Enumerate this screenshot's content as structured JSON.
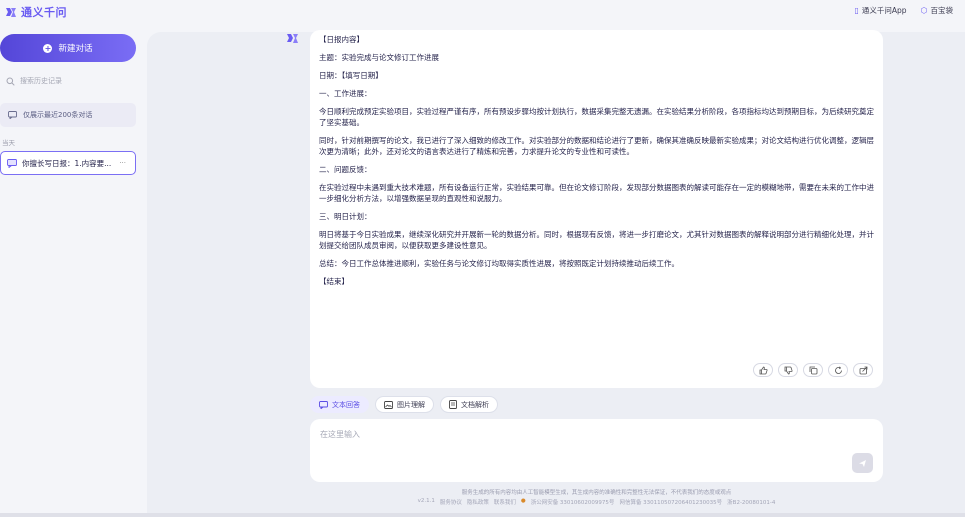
{
  "app": {
    "name": "通义千问",
    "top_links": [
      {
        "icon": "phone-icon",
        "label": "通义千问App"
      },
      {
        "icon": "box-icon",
        "label": "百宝袋"
      }
    ]
  },
  "sidebar": {
    "new_chat_label": "新建对话",
    "search_placeholder": "搜索历史记录",
    "recent_label": "仅展示最近200条对话",
    "day_label": "当天",
    "conversation": "你擅长写日报：1.内容要...",
    "conversation_more": "···"
  },
  "answer": {
    "paragraphs": [
      "【日报内容】",
      "主题：实验完成与论文修订工作进展",
      "日期：【填写日期】",
      "一、工作进展：",
      "今日顺利完成预定实验项目，实验过程严谨有序，所有预设步骤均按计划执行，数据采集完整无遗漏。在实验结果分析阶段，各项指标均达到预期目标，为后续研究奠定了坚实基础。",
      "同时，针对前期撰写的论文，我已进行了深入细致的修改工作。对实验部分的数据和结论进行了更新，确保其准确反映最新实验成果；对论文结构进行优化调整，逻辑层次更为清晰；此外，还对论文的语言表达进行了精炼和完善，力求提升论文的专业性和可读性。",
      "二、问题反馈：",
      "在实验过程中未遇到重大技术难题，所有设备运行正常，实验结果可靠。但在论文修订阶段，发现部分数据图表的解读可能存在一定的模糊地带，需要在未来的工作中进一步细化分析方法，以增强数据呈现的直观性和说服力。",
      "三、明日计划：",
      "明日将基于今日实验成果，继续深化研究并开展新一轮的数据分析。同时，根据现有反馈，将进一步打磨论文，尤其针对数据图表的解释说明部分进行精细化处理，并计划提交给团队成员审阅，以便获取更多建设性意见。",
      "总结：今日工作总体推进顺利，实验任务与论文修订均取得实质性进展，将按照既定计划持续推动后续工作。",
      "【结束】"
    ]
  },
  "modes": [
    {
      "icon": "chat-icon",
      "label": "文本回答",
      "active": true
    },
    {
      "icon": "image-icon",
      "label": "图片理解",
      "active": false
    },
    {
      "icon": "document-icon",
      "label": "文档解析",
      "active": false
    }
  ],
  "input": {
    "placeholder": "在这里输入"
  },
  "footer": {
    "disclaimer": "服务生成的所有内容均由人工智能模型生成，其生成内容的准确性和完整性无法保证，不代表我们的态度或观点",
    "version": "v2.1.1",
    "links": [
      "服务协议",
      "隐私政策",
      "联系我们"
    ],
    "icp1": "浙公网安备 33010602009975号",
    "icp2": "网信算备 330110507206401230035号",
    "icp3": "浙B2-20080101-4"
  },
  "colors": {
    "accent": "#6a5cf2",
    "background": "#f4f5f9",
    "panel": "#eceef4"
  }
}
